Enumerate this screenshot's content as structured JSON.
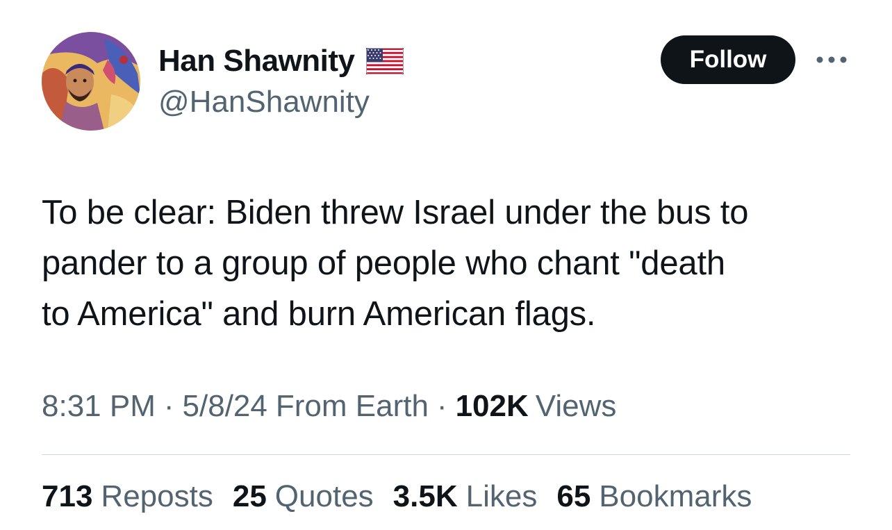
{
  "author": {
    "display_name": "Han Shawnity",
    "handle": "@HanShawnity",
    "badge_icon": "us-flag-icon"
  },
  "actions": {
    "follow_label": "Follow",
    "more_icon": "more-horizontal-icon"
  },
  "tweet": {
    "lines": [
      "To be clear: Biden threw Israel under the bus to",
      "pander to a group of people who chant \"death",
      "to America\" and burn American flags."
    ]
  },
  "meta": {
    "time": "8:31 PM",
    "date": "5/8/24",
    "source": "From Earth",
    "separator": "·",
    "views_count": "102K",
    "views_label": "Views"
  },
  "stats": [
    {
      "count": "713",
      "label": "Reposts"
    },
    {
      "count": "25",
      "label": "Quotes"
    },
    {
      "count": "3.5K",
      "label": "Likes"
    },
    {
      "count": "65",
      "label": "Bookmarks"
    }
  ],
  "colors": {
    "text_primary": "#0f1419",
    "text_secondary": "#536471",
    "follow_bg": "#0f1419",
    "divider": "#cfd9de"
  }
}
